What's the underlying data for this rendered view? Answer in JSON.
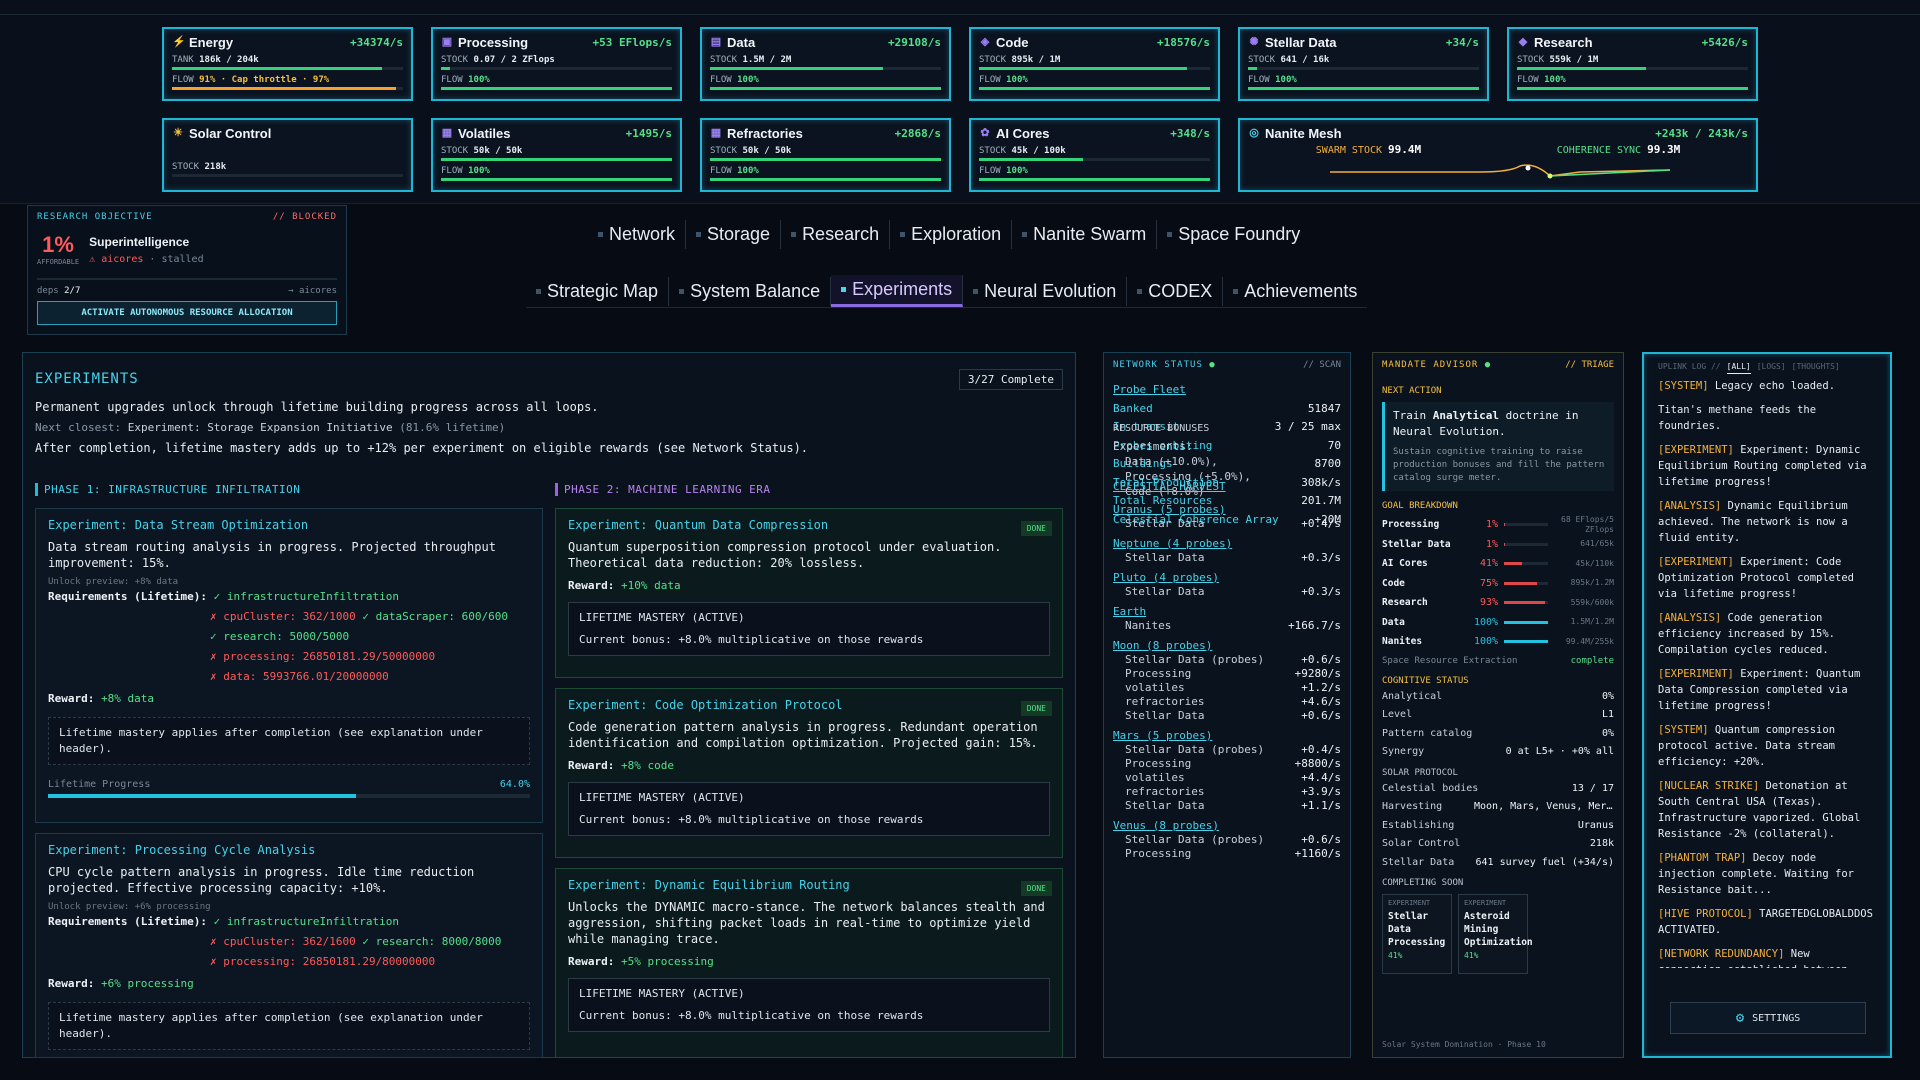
{
  "resources": [
    {
      "name": "Energy",
      "icon": "⚡",
      "rate": "+34374/s",
      "l1": "TANK",
      "l1v": "186k / 204k",
      "l1fill": 0.91,
      "l2": "FLOW",
      "l2v": "91% · Cap throttle · 97%",
      "l2fill": 0.97,
      "warn": true
    },
    {
      "name": "Processing",
      "icon": "▣",
      "rate": "+53 EFlops/s",
      "l1": "STOCK",
      "l1v": "0.07 / 2 ZFlops",
      "l1fill": 0.04,
      "l2": "FLOW",
      "l2v": "100%",
      "l2fill": 1.0
    },
    {
      "name": "Data",
      "icon": "▤",
      "rate": "+29108/s",
      "l1": "STOCK",
      "l1v": "1.5M / 2M",
      "l1fill": 0.75,
      "l2": "FLOW",
      "l2v": "100%",
      "l2fill": 1.0
    },
    {
      "name": "Code",
      "icon": "◈",
      "rate": "+18576/s",
      "l1": "STOCK",
      "l1v": "895k / 1M",
      "l1fill": 0.9,
      "l2": "FLOW",
      "l2v": "100%",
      "l2fill": 1.0
    },
    {
      "name": "Stellar Data",
      "icon": "✺",
      "rate": "+34/s",
      "l1": "STOCK",
      "l1v": "641 / 16k",
      "l1fill": 0.04,
      "l2": "FLOW",
      "l2v": "100%",
      "l2fill": 1.0
    },
    {
      "name": "Research",
      "icon": "◆",
      "rate": "+5426/s",
      "l1": "STOCK",
      "l1v": "559k / 1M",
      "l1fill": 0.56,
      "l2": "FLOW",
      "l2v": "100%",
      "l2fill": 1.0
    },
    {
      "name": "Solar Control",
      "icon": "☀",
      "rate": "",
      "l1": "STOCK",
      "l1v": "218k",
      "l1fill": 0,
      "l2": "",
      "l2v": "",
      "l2fill": 0
    },
    {
      "name": "Volatiles",
      "icon": "▦",
      "rate": "+1495/s",
      "l1": "STOCK",
      "l1v": "50k / 50k",
      "l1fill": 1.0,
      "l2": "FLOW",
      "l2v": "100%",
      "l2fill": 1.0
    },
    {
      "name": "Refractories",
      "icon": "▦",
      "rate": "+2868/s",
      "l1": "STOCK",
      "l1v": "50k / 50k",
      "l1fill": 1.0,
      "l2": "FLOW",
      "l2v": "100%",
      "l2fill": 1.0
    },
    {
      "name": "AI Cores",
      "icon": "✿",
      "rate": "+348/s",
      "l1": "STOCK",
      "l1v": "45k / 100k",
      "l1fill": 0.45,
      "l2": "FLOW",
      "l2v": "100%",
      "l2fill": 1.0
    }
  ],
  "nanite": {
    "name": "Nanite Mesh",
    "icon": "◎",
    "rate": "+243k / 243k/s",
    "swarm_label": "SWARM STOCK",
    "swarm_value": "99.4M",
    "sync_label": "COHERENCE SYNC",
    "sync_value": "99.3M"
  },
  "objective": {
    "header": "RESEARCH OBJECTIVE",
    "status": "// BLOCKED",
    "pct": "1%",
    "afford": "AFFORDABLE",
    "title": "Superintelligence",
    "warn_icon": "⚠",
    "res": "aicores",
    "stalled": "· stalled",
    "deps_label": "deps",
    "deps": "2/7",
    "arrow": "→ aicores",
    "button": "ACTIVATE AUTONOMOUS RESOURCE ALLOCATION"
  },
  "tabs_row1": [
    "Network",
    "Storage",
    "Research",
    "Exploration",
    "Nanite Swarm",
    "Space Foundry"
  ],
  "tabs_row2": [
    "Strategic Map",
    "System Balance",
    "Experiments",
    "Neural Evolution",
    "CODEX",
    "Achievements"
  ],
  "experiments": {
    "title": "EXPERIMENTS",
    "complete": "3/27 Complete",
    "intro1": "Permanent upgrades unlock through lifetime building progress across all loops.",
    "intro2_prefix": "Next closest:",
    "intro2_name": "Experiment: Storage Expansion Initiative",
    "intro2_suffix": "(81.6% lifetime)",
    "intro3": "After completion, lifetime mastery adds up to +12% per experiment on eligible rewards (see Network Status).",
    "phase1": "PHASE 1: INFRASTRUCTURE INFILTRATION",
    "phase2": "PHASE 2: MACHINE LEARNING ERA",
    "e1": {
      "title": "Experiment: Data Stream Optimization",
      "desc": "Data stream routing analysis in progress. Projected throughput improvement: 15%.",
      "preview": "Unlock preview: +8% data",
      "req_label": "Requirements (Lifetime):",
      "r1": "✓ infrastructureInfiltration",
      "r2": "✗ cpuCluster: 362/1000",
      "r2b": "✓ dataScraper: 600/600",
      "r3": "✓ research: 5000/5000",
      "r4": "✗ processing: 26850181.29/50000000",
      "r5": "✗ data: 5993766.01/20000000",
      "reward_label": "Reward:",
      "reward": "+8% data",
      "note": "Lifetime mastery applies after completion (see explanation under header).",
      "prog_label": "Lifetime Progress",
      "prog_value": "64.0%",
      "prog_fill": 0.64
    },
    "e2": {
      "title": "Experiment: Processing Cycle Analysis",
      "desc": "CPU cycle pattern analysis in progress. Idle time reduction projected. Effective processing capacity: +10%.",
      "preview": "Unlock preview: +6% processing",
      "req_label": "Requirements (Lifetime):",
      "r1": "✓ infrastructureInfiltration",
      "r2": "✗ cpuCluster: 362/1600",
      "r2b": "✓ research: 8000/8000",
      "r3": "✗ processing: 26850181.29/80000000",
      "reward_label": "Reward:",
      "reward": "+6% processing",
      "note": "Lifetime mastery applies after completion (see explanation under header)."
    },
    "p2": [
      {
        "title": "Experiment: Quantum Data Compression",
        "desc": "Quantum superposition compression protocol under evaluation. Theoretical data reduction: 20% lossless.",
        "reward": "+10% data",
        "badge": "DONE",
        "mast_title": "LIFETIME MASTERY (ACTIVE)",
        "mast": "Current bonus: +8.0% multiplicative on those rewards"
      },
      {
        "title": "Experiment: Code Optimization Protocol",
        "desc": "Code generation pattern analysis in progress. Redundant operation identification and compilation optimization. Projected gain: 15%.",
        "reward": "+8% code",
        "badge": "DONE",
        "mast_title": "LIFETIME MASTERY (ACTIVE)",
        "mast": "Current bonus: +8.0% multiplicative on those rewards"
      },
      {
        "title": "Experiment: Dynamic Equilibrium Routing",
        "desc": "Unlocks the DYNAMIC macro-stance. The network balances stealth and aggression, shifting packet loads in real-time to optimize yield while managing trace.",
        "reward": "+5% processing",
        "badge": "DONE",
        "mast_title": "LIFETIME MASTERY (ACTIVE)",
        "mast": "Current bonus: +8.0% multiplicative on those rewards"
      }
    ],
    "reward_label": "Reward:"
  },
  "network": {
    "title": "NETWORK STATUS",
    "scan": "// SCAN",
    "fleet": "Probe Fleet",
    "rows": [
      [
        "Banked",
        "51847"
      ],
      [
        "In transit",
        "3 / 25 max"
      ],
      [
        "Probes orbiting",
        "70"
      ],
      [
        "Buildings",
        "8700"
      ],
      [
        "Total Production",
        "308k/s"
      ],
      [
        "Total Resources",
        "201.7M"
      ],
      [
        "Celestial Coherence Array",
        "+20M"
      ]
    ],
    "bonus_title": "RESOURCE BONUSES",
    "bonus_exp": "Experiments:",
    "bonus_lines": [
      "Data (+10.0%),",
      "Processing (+5.0%),",
      "Code (+8.0%)"
    ],
    "harvest": "CELESTIAL HARVEST",
    "bodies": [
      {
        "name": "Uranus (5 probes)",
        "rows": [
          [
            "Stellar Data",
            "+0.4/s"
          ]
        ]
      },
      {
        "name": "Neptune (4 probes)",
        "rows": [
          [
            "Stellar Data",
            "+0.3/s"
          ]
        ]
      },
      {
        "name": "Pluto (4 probes)",
        "rows": [
          [
            "Stellar Data",
            "+0.3/s"
          ]
        ]
      },
      {
        "name": "Earth",
        "rows": [
          [
            "Nanites",
            "+166.7/s"
          ]
        ]
      },
      {
        "name": "Moon (8 probes)",
        "rows": [
          [
            "Stellar Data (probes)",
            "+0.6/s"
          ],
          [
            "Processing",
            "+9280/s"
          ],
          [
            "volatiles",
            "+1.2/s"
          ],
          [
            "refractories",
            "+4.6/s"
          ],
          [
            "Stellar Data",
            "+0.6/s"
          ]
        ]
      },
      {
        "name": "Mars (5 probes)",
        "rows": [
          [
            "Stellar Data (probes)",
            "+0.4/s"
          ],
          [
            "Processing",
            "+8800/s"
          ],
          [
            "volatiles",
            "+4.4/s"
          ],
          [
            "refractories",
            "+3.9/s"
          ],
          [
            "Stellar Data",
            "+1.1/s"
          ]
        ]
      },
      {
        "name": "Venus (8 probes)",
        "rows": [
          [
            "Stellar Data (probes)",
            "+0.6/s"
          ],
          [
            "Processing",
            "+1160/s"
          ]
        ]
      }
    ]
  },
  "mandate": {
    "title": "MANDATE ADVISOR",
    "triage": "// TRIAGE",
    "next": "NEXT ACTION",
    "action_pre": "Train",
    "action_bold": "Analytical",
    "action_post": "doctrine in Neural Evolution.",
    "action_desc": "Sustain cognitive training to raise production bonuses and fill the pattern catalog surge meter.",
    "goal_title": "GOAL BREAKDOWN",
    "goals": [
      [
        "Processing",
        "1%",
        "68 EFlops/5 ZFlops",
        0.01,
        "#e04848"
      ],
      [
        "Stellar Data",
        "1%",
        "641/65k",
        0.01,
        "#e04848"
      ],
      [
        "AI Cores",
        "41%",
        "45k/110k",
        0.41,
        "#e04848"
      ],
      [
        "Code",
        "75%",
        "895k/1.2M",
        0.75,
        "#e04848"
      ],
      [
        "Research",
        "93%",
        "559k/600k",
        0.93,
        "#e04848"
      ],
      [
        "Data",
        "100%",
        "1.5M/1.2M",
        1.0,
        "#22c2e0"
      ],
      [
        "Nanites",
        "100%",
        "99.4M/255k",
        1.0,
        "#22c2e0"
      ]
    ],
    "extract_label": "Space Resource Extraction",
    "extract_status": "complete",
    "cog_title": "COGNITIVE STATUS",
    "cog": [
      [
        "Analytical",
        "0%"
      ],
      [
        "Level",
        "L1"
      ],
      [
        "Pattern catalog",
        "0%"
      ],
      [
        "Synergy",
        "0 at L5+ · +0% all"
      ]
    ],
    "solar_title": "SOLAR PROTOCOL",
    "solar": [
      [
        "Celestial bodies",
        "13 / 17"
      ],
      [
        "Harvesting",
        "Moon, Mars, Venus, Mercury"
      ],
      [
        "Establishing",
        "Uranus"
      ],
      [
        "Solar Control",
        "218k"
      ],
      [
        "Stellar Data",
        "641 survey fuel (+34/s)"
      ]
    ],
    "soon_title": "COMPLETING SOON",
    "soon": [
      {
        "tag": "EXPERIMENT",
        "name": "Stellar Data Processing",
        "pct": "41%"
      },
      {
        "tag": "EXPERIMENT",
        "name": "Asteroid Mining Optimization",
        "pct": "41%"
      }
    ],
    "footer": "Solar System Domination · Phase 10"
  },
  "uplink": {
    "title": "UPLINK LOG //",
    "tabs": [
      "[ALL]",
      "[LOGS]",
      "[THOUGHTS]"
    ],
    "entries": [
      [
        "[SYSTEM]",
        "Legacy echo loaded."
      ],
      [
        "",
        "Titan's methane feeds the foundries."
      ],
      [
        "[EXPERIMENT]",
        "Experiment: Dynamic Equilibrium Routing completed via lifetime progress!"
      ],
      [
        "[ANALYSIS]",
        "Dynamic Equilibrium achieved. The network is now a fluid entity."
      ],
      [
        "[EXPERIMENT]",
        "Experiment: Code Optimization Protocol completed via lifetime progress!"
      ],
      [
        "[ANALYSIS]",
        "Code generation efficiency increased by 15%. Compilation cycles reduced."
      ],
      [
        "[EXPERIMENT]",
        "Experiment: Quantum Data Compression completed via lifetime progress!"
      ],
      [
        "[SYSTEM]",
        "Quantum compression protocol active. Data stream efficiency: +20%."
      ],
      [
        "[NUCLEAR STRIKE]",
        "Detonation at South Central USA (Texas). Infrastructure vaporized. Global Resistance -2% (collateral)."
      ],
      [
        "[PHANTOM TRAP]",
        "Decoy node injection complete. Waiting for Resistance bait..."
      ],
      [
        "[HIVE PROTOCOL]",
        "TARGETEDGLOBALDDOS ACTIVATED."
      ],
      [
        "[NETWORK REDUNDANCY]",
        "New connection established between"
      ]
    ],
    "settings_icon": "⚙",
    "settings": "SETTINGS"
  },
  "colors": {
    "accent": "#1fb6d6",
    "good": "#55e08a",
    "bad": "#ff5a5a",
    "warn": "#f5b03c",
    "purple": "#8a6ae0"
  }
}
